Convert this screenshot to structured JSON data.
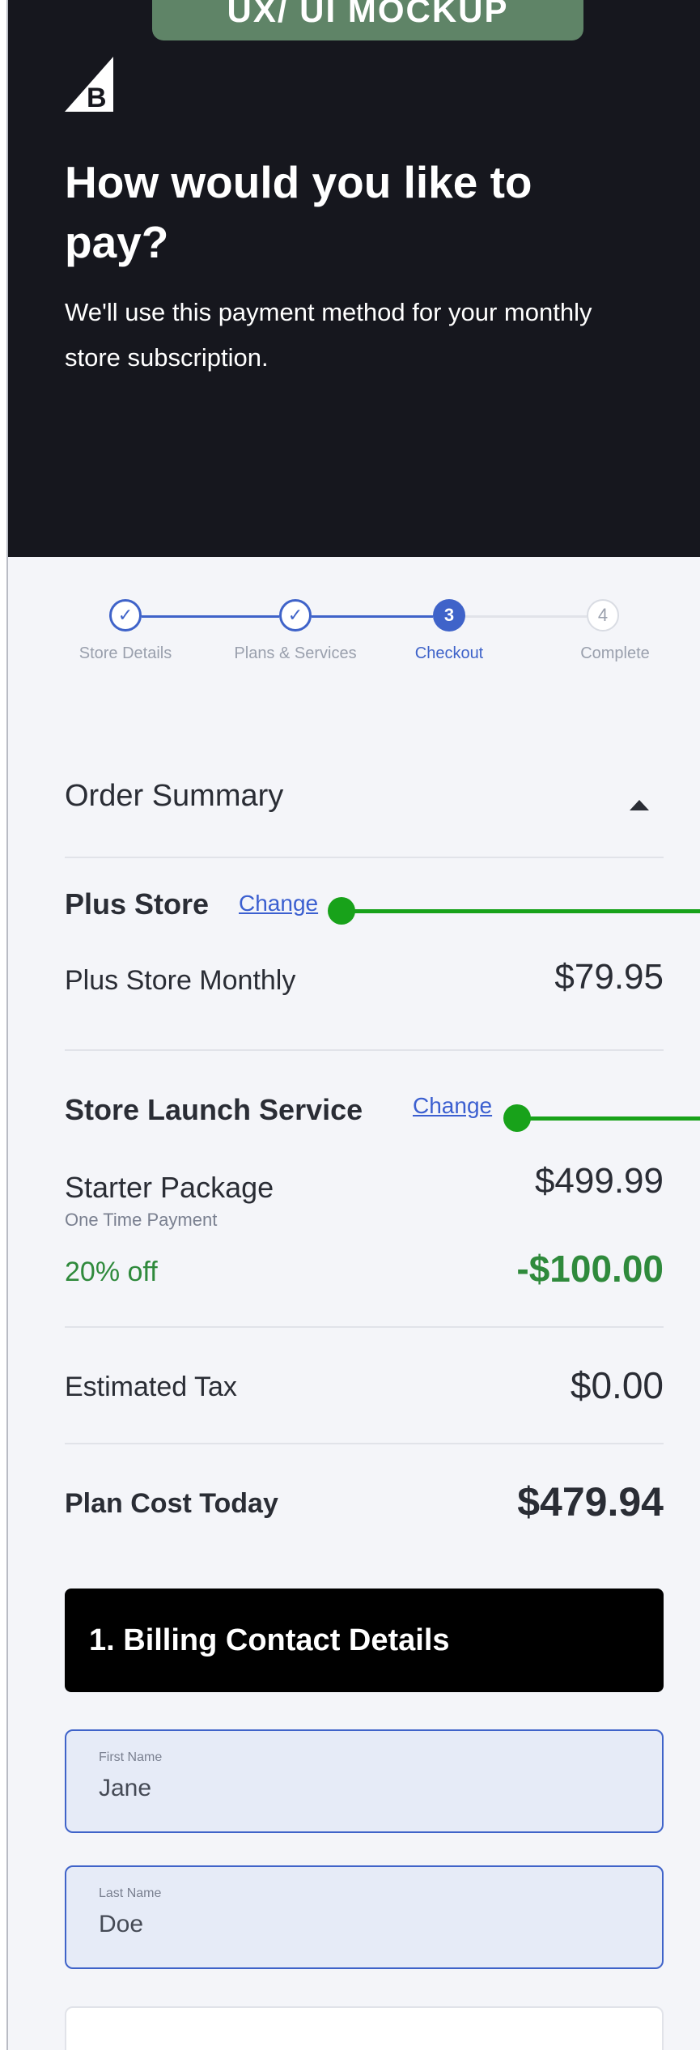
{
  "mockup_badge": "UX/ UI MOCKUP",
  "hero": {
    "title": "How would you like to pay?",
    "subtitle": "We'll use this payment method for your monthly store subscription."
  },
  "stepper": {
    "steps": [
      {
        "label": "Store Details",
        "marker": "✓",
        "status": "done"
      },
      {
        "label": "Plans & Services",
        "marker": "✓",
        "status": "done"
      },
      {
        "label": "Checkout",
        "marker": "3",
        "status": "current"
      },
      {
        "label": "Complete",
        "marker": "4",
        "status": "upcoming"
      }
    ]
  },
  "order_summary": {
    "title": "Order Summary",
    "plus_store": {
      "heading": "Plus Store",
      "change": "Change",
      "item": "Plus Store Monthly",
      "price": "$79.95"
    },
    "launch_service": {
      "heading": "Store Launch Service",
      "change": "Change",
      "item": "Starter Package",
      "item_note": "One Time Payment",
      "price": "$499.99",
      "discount_label": "20% off",
      "discount_value": "-$100.00"
    },
    "tax": {
      "label": "Estimated Tax",
      "value": "$0.00"
    },
    "total": {
      "label": "Plan Cost Today",
      "value": "$479.94"
    }
  },
  "billing": {
    "title": "1. Billing Contact Details",
    "first_name": {
      "label": "First Name",
      "value": "Jane"
    },
    "last_name": {
      "label": "Last Name",
      "value": "Doe"
    }
  },
  "colors": {
    "hero_bg": "#16171e",
    "accent_blue": "#3f63c9",
    "discount_green": "#2f8a3c",
    "annotation_green": "#18a21a",
    "badge_green": "#5f8467"
  }
}
